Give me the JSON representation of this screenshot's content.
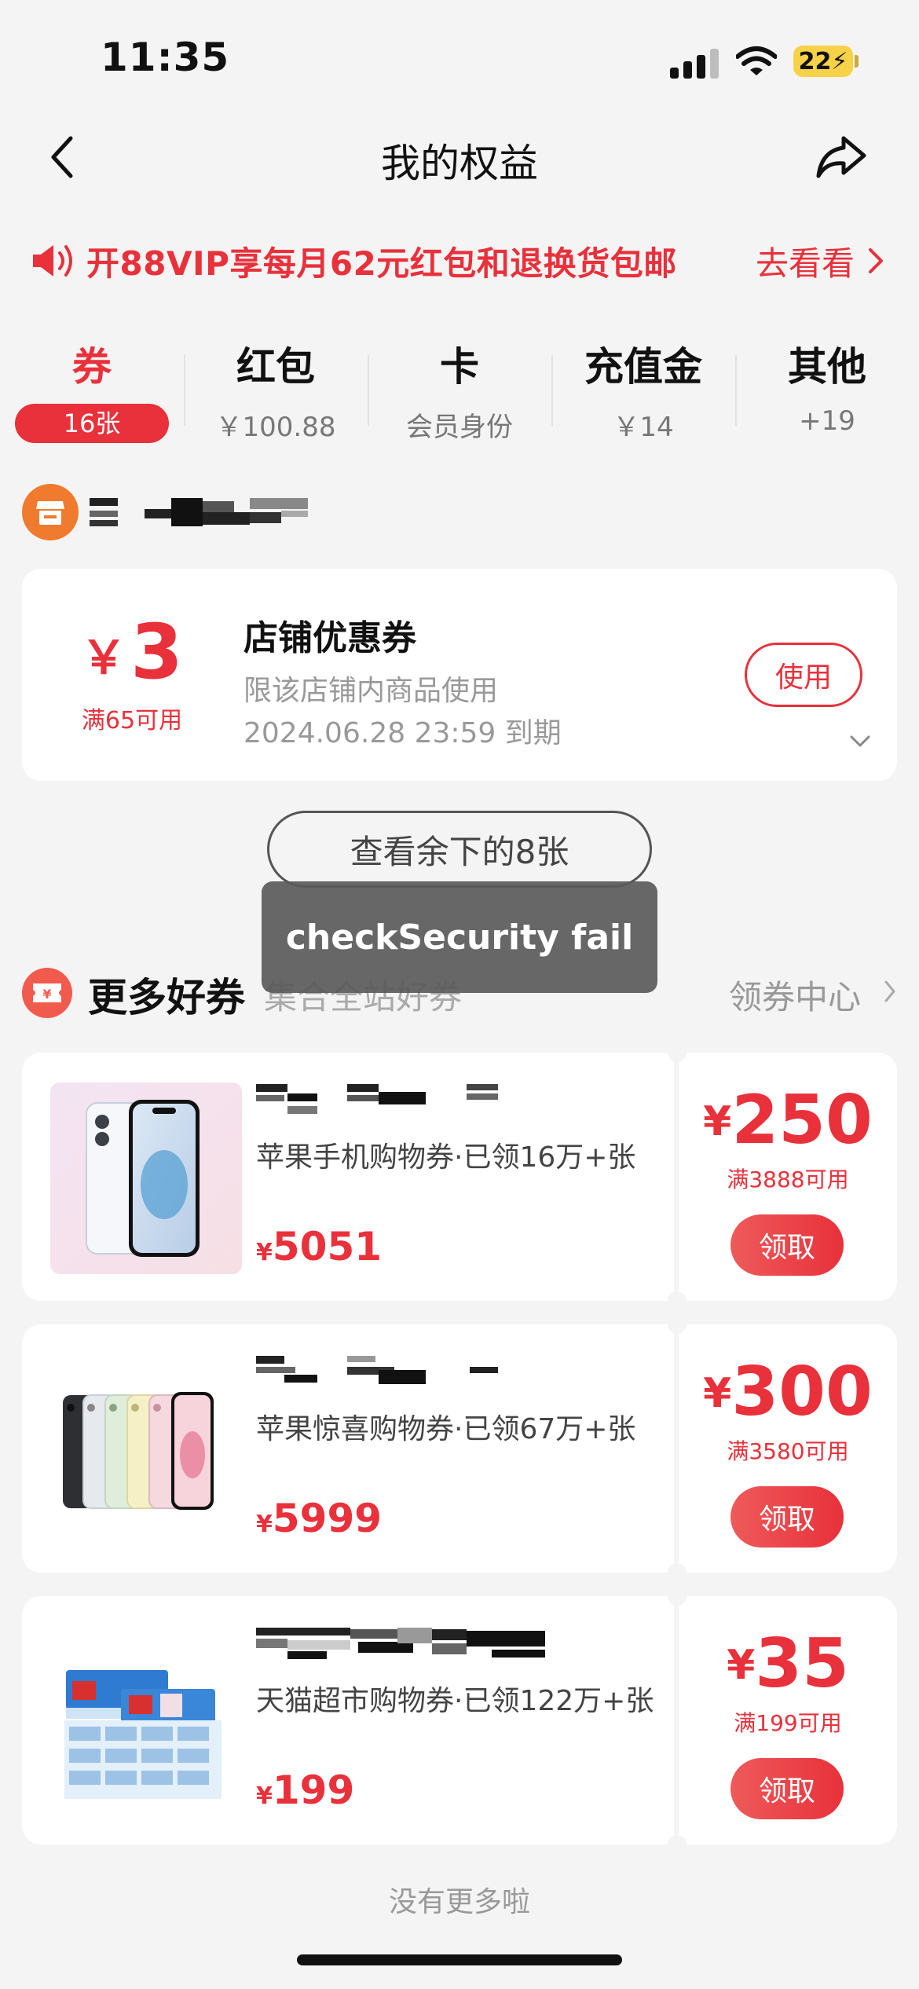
{
  "status_bar": {
    "time": "11:35",
    "battery": "22"
  },
  "nav": {
    "title": "我的权益"
  },
  "promo": {
    "text": "开88VIP享每月62元红包和退换货包邮",
    "link": "去看看"
  },
  "tabs": [
    {
      "label": "券",
      "sub": "16张"
    },
    {
      "label": "红包",
      "sub": "￥100.88"
    },
    {
      "label": "卡",
      "sub": "会员身份"
    },
    {
      "label": "充值金",
      "sub": "￥14"
    },
    {
      "label": "其他",
      "sub": "+19"
    }
  ],
  "coupon": {
    "currency": "￥",
    "amount": "3",
    "condition": "满65可用",
    "title": "店铺优惠券",
    "desc": "限该店铺内商品使用",
    "expire": "2024.06.28 23:59 到期",
    "use_label": "使用"
  },
  "view_more": "查看余下的8张",
  "toast": "checkSecurity fail",
  "section": {
    "title": "更多好券",
    "sub": "集合全站好券",
    "link": "领券中心"
  },
  "deals": [
    {
      "name": "苹果手机购物券·已领16万+张",
      "price_currency": "¥",
      "price": "5051",
      "currency": "¥",
      "amount": "250",
      "condition": "满3888可用",
      "claim": "领取"
    },
    {
      "name": "苹果惊喜购物券·已领67万+张",
      "price_currency": "¥",
      "price": "5999",
      "currency": "¥",
      "amount": "300",
      "condition": "满3580可用",
      "claim": "领取"
    },
    {
      "name": "天猫超市购物券·已领122万+张",
      "price_currency": "¥",
      "price": "199",
      "currency": "¥",
      "amount": "35",
      "condition": "满199可用",
      "claim": "领取"
    }
  ],
  "footer": {
    "no_more": "没有更多啦"
  },
  "colors": {
    "accent": "#e8313b",
    "store": "#f07a2d",
    "battery": "#f7d148"
  }
}
